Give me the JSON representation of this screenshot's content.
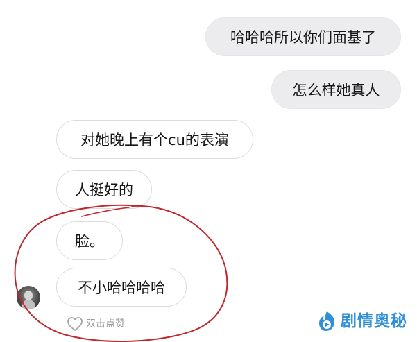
{
  "messages": [
    {
      "side": "out",
      "text": "哈哈哈所以你们面基了"
    },
    {
      "side": "out",
      "text": "怎么样她真人"
    },
    {
      "side": "in",
      "text": "对她晚上有个cu的表演"
    },
    {
      "side": "in",
      "text": "人挺好的"
    },
    {
      "side": "in",
      "text": "脸。"
    },
    {
      "side": "in",
      "text": "不小哈哈哈哈"
    }
  ],
  "like": {
    "icon": "heart-outline-icon",
    "label": "双击点赞"
  },
  "annotation": {
    "color": "#c0282e",
    "shape": "hand-drawn-circle"
  },
  "watermark": {
    "icon": "play-logo-icon",
    "text": "剧情奥秘",
    "color": "#2f8fd8"
  }
}
